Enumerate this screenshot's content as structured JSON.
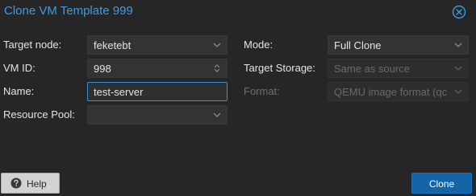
{
  "dialog": {
    "title": "Clone VM Template 999"
  },
  "form": {
    "target_node": {
      "label": "Target node:",
      "value": "feketebt"
    },
    "vm_id": {
      "label": "VM ID:",
      "value": "998"
    },
    "name": {
      "label": "Name:",
      "value": "test-server"
    },
    "resource_pool": {
      "label": "Resource Pool:",
      "value": ""
    },
    "mode": {
      "label": "Mode:",
      "value": "Full Clone"
    },
    "target_storage": {
      "label": "Target Storage:",
      "value": "Same as source"
    },
    "format": {
      "label": "Format:",
      "value": "QEMU image format (qc"
    }
  },
  "footer": {
    "help_label": "Help",
    "clone_label": "Clone"
  },
  "colors": {
    "title": "#3c9ce3",
    "primary_button": "#1464a8",
    "focus_border": "#3c8fd6"
  },
  "icons": {
    "close": "close-circle-icon",
    "dropdown": "chevron-down-icon",
    "spinner": "spinner-arrows-icon",
    "help": "question-circle-icon"
  }
}
